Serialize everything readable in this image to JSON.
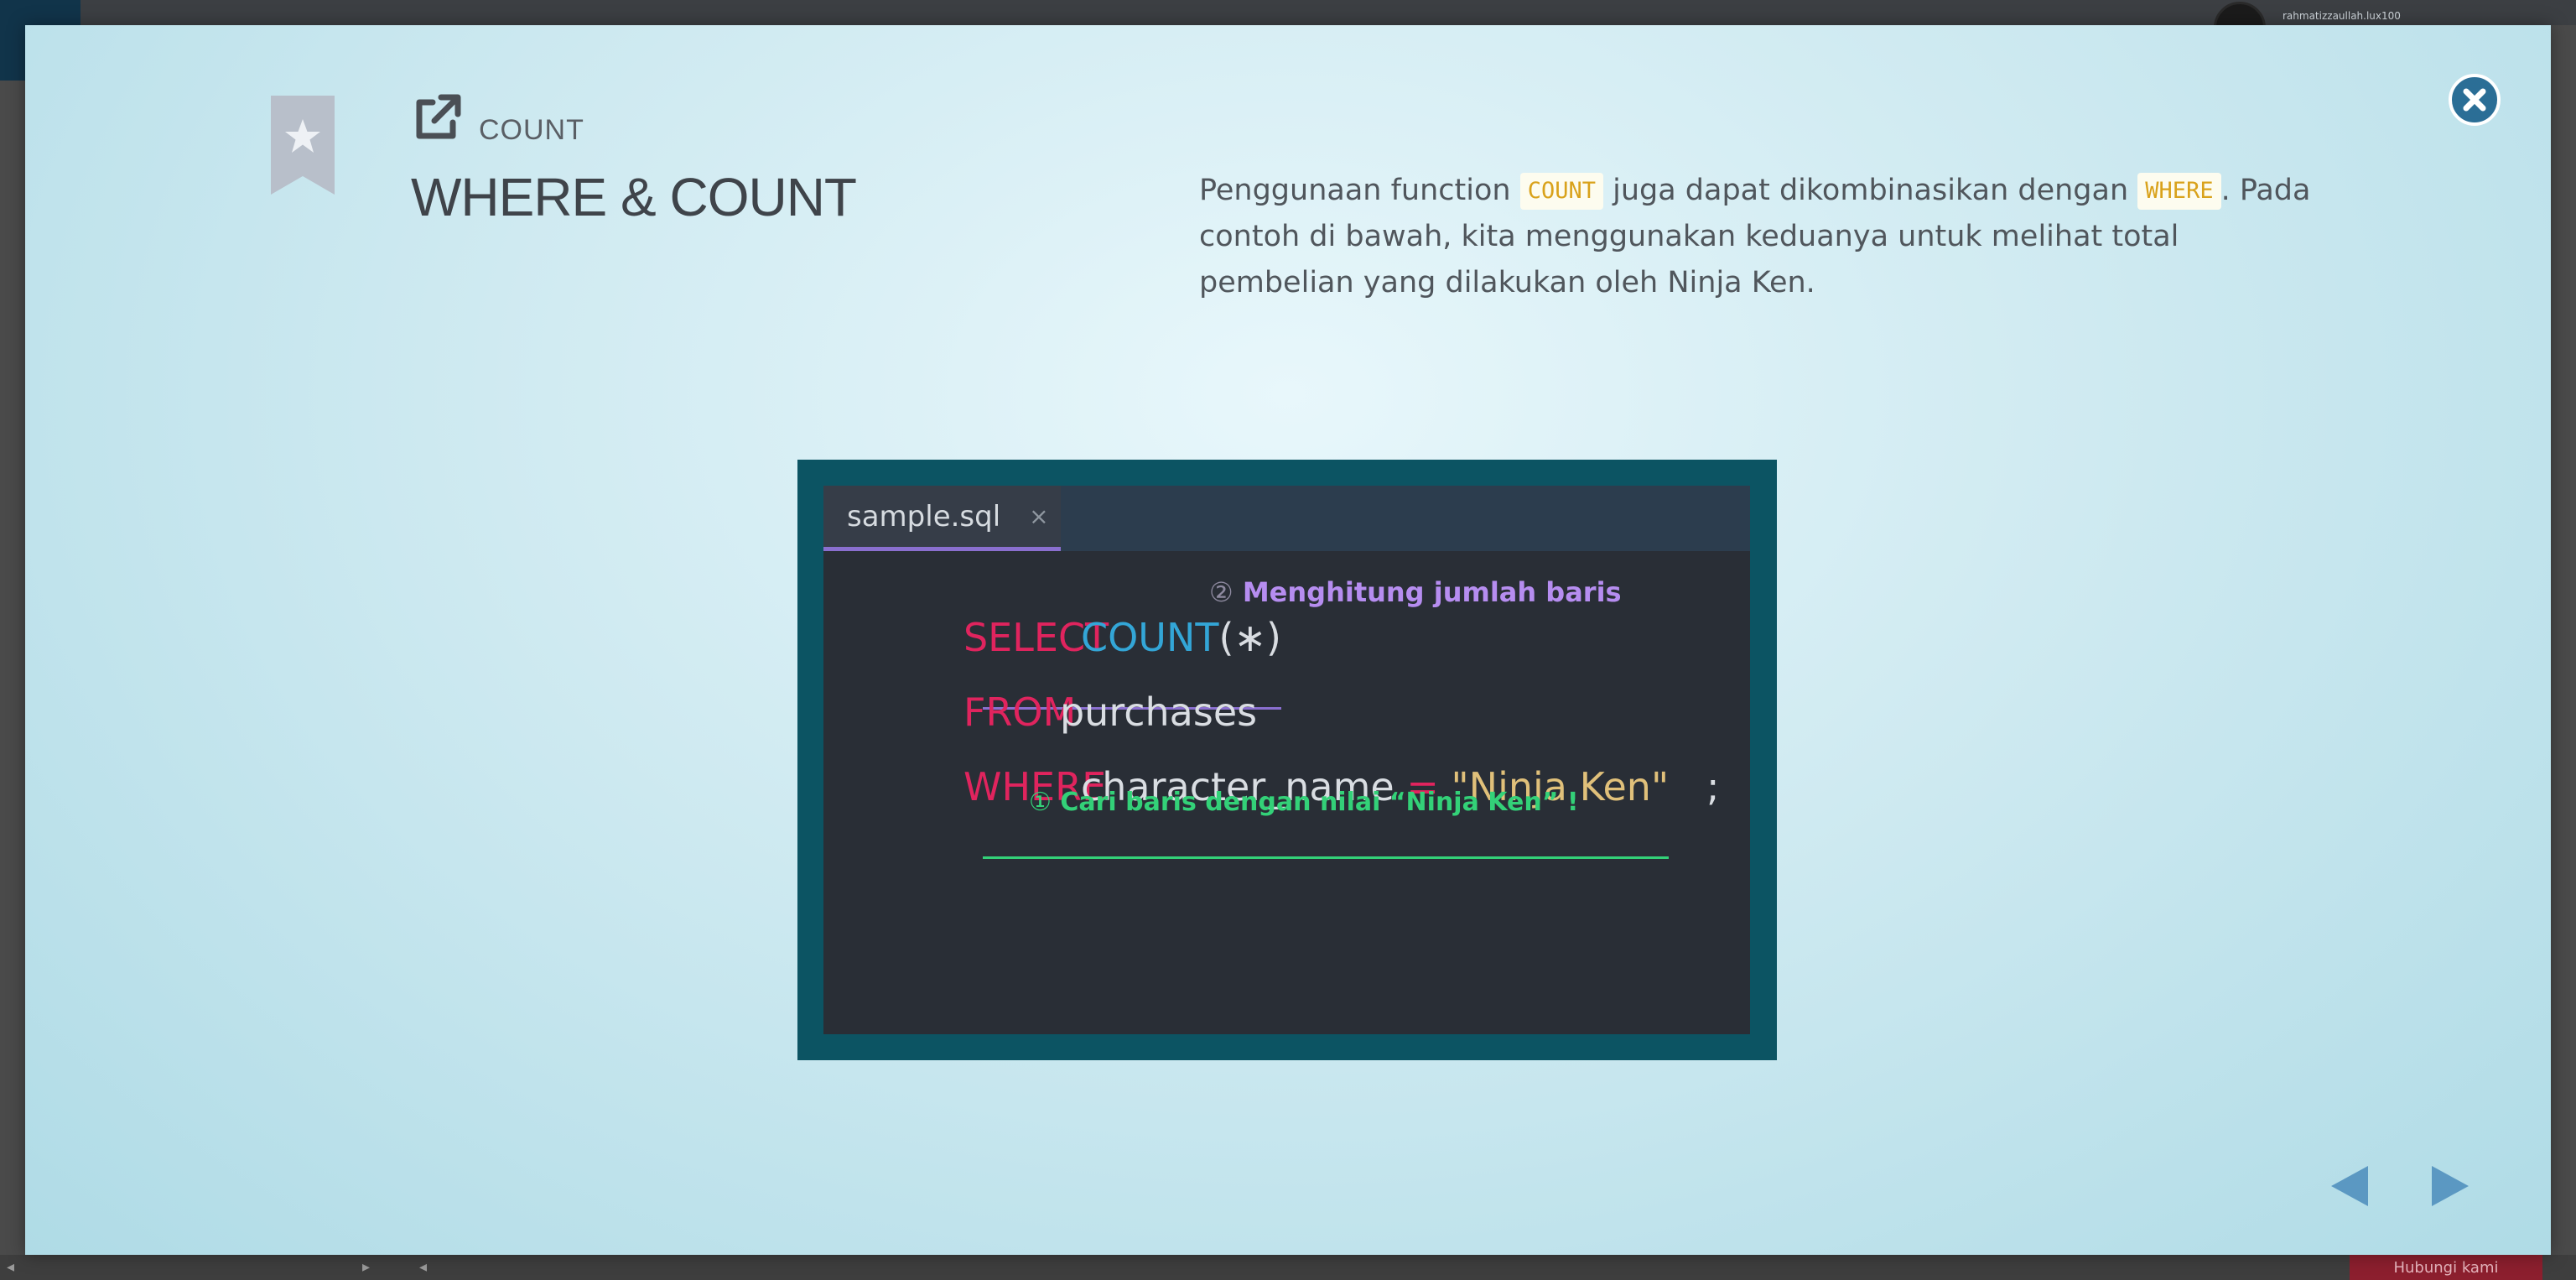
{
  "background": {
    "username": "rahmatizzaullah.lux100",
    "hint_button": "Hubungi kami"
  },
  "lesson": {
    "category": "COUNT",
    "title": "WHERE & COUNT",
    "description": {
      "part1": "Penggunaan function ",
      "code1": "COUNT",
      "part2": " juga dapat dikombinasikan dengan ",
      "code2": "WHERE",
      "part3": ". Pada contoh di bawah, kita menggunakan keduanya untuk melihat total pembelian yang dilakukan oleh Ninja Ken."
    }
  },
  "editor": {
    "tab_name": "sample.sql",
    "tab_close": "×",
    "line1": {
      "kw": "SELECT",
      "fn": "COUNT",
      "args": "(∗)"
    },
    "line2": {
      "kw": "FROM",
      "table": "purchases"
    },
    "line3": {
      "kw": "WHERE",
      "col": "character_name",
      "op": "=",
      "val": "\"Ninja Ken\"",
      "end": ";"
    },
    "annotation2": {
      "num": "②",
      "text": "Menghitung jumlah baris"
    },
    "annotation1": {
      "num": "①",
      "text": "Cari baris dengan nilai “Ninja Ken” !"
    }
  },
  "colors": {
    "keyword": "#e0245e",
    "function": "#33a6d7",
    "string": "#e0c07a",
    "annotation_purple": "#b68df0",
    "annotation_green": "#33d178",
    "modal_close": "#2b6e96",
    "nav_arrow": "#5b98c2"
  },
  "icons": {
    "bookmark": "bookmark-star-icon",
    "lesson": "external-link-icon",
    "close": "close-circle-icon",
    "prev": "triangle-left-icon",
    "next": "triangle-right-icon"
  }
}
